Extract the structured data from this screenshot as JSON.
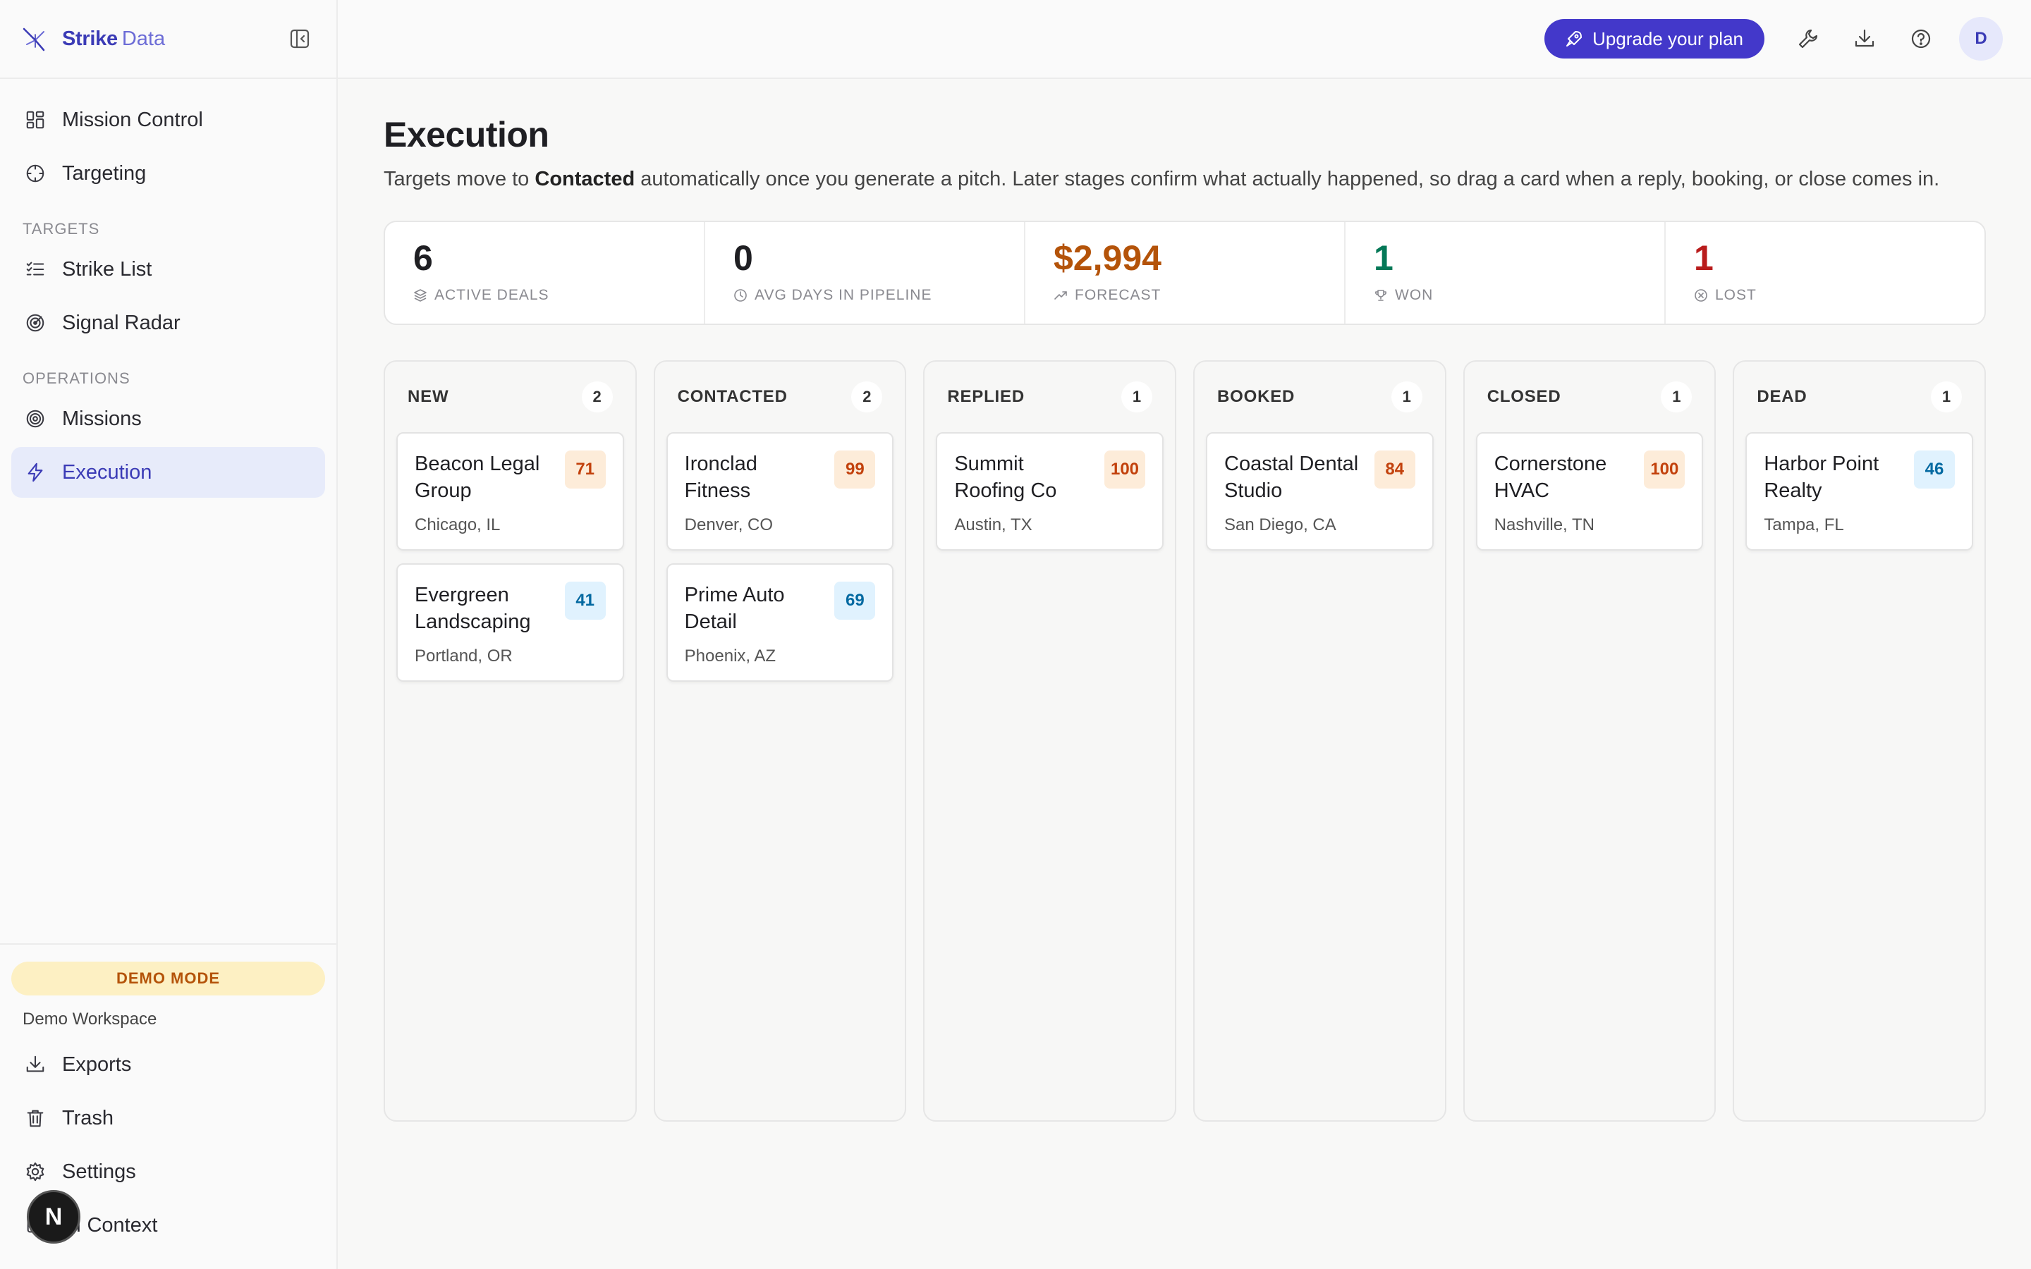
{
  "brand": {
    "name": "Strike",
    "sub": "Data"
  },
  "nav": {
    "top": [
      {
        "label": "Mission Control"
      },
      {
        "label": "Targeting"
      }
    ],
    "section_targets": "TARGETS",
    "targets": [
      {
        "label": "Strike List"
      },
      {
        "label": "Signal Radar"
      }
    ],
    "section_operations": "OPERATIONS",
    "operations": [
      {
        "label": "Missions"
      },
      {
        "label": "Execution"
      }
    ]
  },
  "sidebar_bottom": {
    "demo_mode": "DEMO MODE",
    "workspace": "Demo Workspace",
    "items": [
      {
        "label": "Exports"
      },
      {
        "label": "Trash"
      },
      {
        "label": "Settings"
      },
      {
        "label": "AI Context"
      }
    ]
  },
  "topbar": {
    "upgrade_label": "Upgrade your plan",
    "avatar_initial": "D"
  },
  "page": {
    "title": "Execution",
    "subtitle_pre": "Targets move to ",
    "subtitle_bold": "Contacted",
    "subtitle_post": " automatically once you generate a pitch. Later stages confirm what actually happened, so drag a card when a reply, booking, or close comes in."
  },
  "stats": [
    {
      "value": "6",
      "label": "ACTIVE DEALS",
      "color": "#1f1f23"
    },
    {
      "value": "0",
      "label": "AVG DAYS IN PIPELINE",
      "color": "#1f1f23"
    },
    {
      "value": "$2,994",
      "label": "FORECAST",
      "color": "#b45309"
    },
    {
      "value": "1",
      "label": "WON",
      "color": "#047857"
    },
    {
      "value": "1",
      "label": "LOST",
      "color": "#b91c1c"
    }
  ],
  "columns": [
    {
      "name": "NEW",
      "count": "2",
      "cards": [
        {
          "name": "Beacon Legal Group",
          "location": "Chicago, IL",
          "score": "71",
          "tone": "warm"
        },
        {
          "name": "Evergreen Landscaping",
          "location": "Portland, OR",
          "score": "41",
          "tone": "cool"
        }
      ]
    },
    {
      "name": "CONTACTED",
      "count": "2",
      "cards": [
        {
          "name": "Ironclad Fitness",
          "location": "Denver, CO",
          "score": "99",
          "tone": "warm"
        },
        {
          "name": "Prime Auto Detail",
          "location": "Phoenix, AZ",
          "score": "69",
          "tone": "cool"
        }
      ]
    },
    {
      "name": "REPLIED",
      "count": "1",
      "cards": [
        {
          "name": "Summit Roofing Co",
          "location": "Austin, TX",
          "score": "100",
          "tone": "warm"
        }
      ]
    },
    {
      "name": "BOOKED",
      "count": "1",
      "cards": [
        {
          "name": "Coastal Dental Studio",
          "location": "San Diego, CA",
          "score": "84",
          "tone": "warm"
        }
      ]
    },
    {
      "name": "CLOSED",
      "count": "1",
      "cards": [
        {
          "name": "Cornerstone HVAC",
          "location": "Nashville, TN",
          "score": "100",
          "tone": "warm"
        }
      ]
    },
    {
      "name": "DEAD",
      "count": "1",
      "cards": [
        {
          "name": "Harbor Point Realty",
          "location": "Tampa, FL",
          "score": "46",
          "tone": "cool"
        }
      ]
    }
  ],
  "overlay_badge": "N"
}
